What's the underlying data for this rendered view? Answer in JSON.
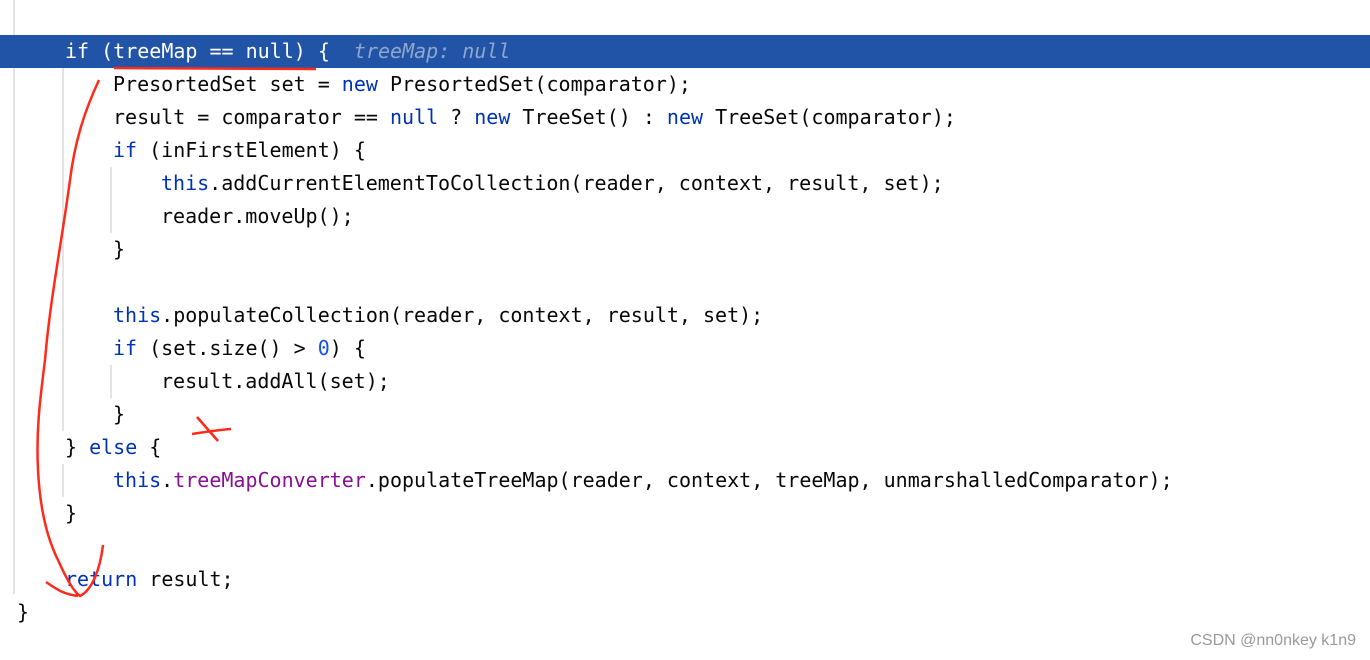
{
  "colors": {
    "highlight": "#2154a6",
    "keyword": "#0033b3",
    "number": "#1750eb",
    "field": "#871094",
    "annotation": "#ff2a1a"
  },
  "inline_hint": "treeMap: null",
  "highlighted_line": 0,
  "code_lines": [
    {
      "indent": 1,
      "tokens": [
        [
          "if",
          "kw"
        ],
        [
          " (treeMap == null) {",
          ""
        ]
      ]
    },
    {
      "indent": 2,
      "tokens": [
        [
          "PresortedSet set = ",
          ""
        ],
        [
          "new",
          "kw"
        ],
        [
          " PresortedSet(comparator);",
          ""
        ]
      ]
    },
    {
      "indent": 2,
      "tokens": [
        [
          "result = comparator == ",
          ""
        ],
        [
          "null",
          "kw"
        ],
        [
          " ? ",
          ""
        ],
        [
          "new",
          "kw"
        ],
        [
          " TreeSet() : ",
          ""
        ],
        [
          "new",
          "kw"
        ],
        [
          " TreeSet(comparator);",
          ""
        ]
      ]
    },
    {
      "indent": 2,
      "tokens": [
        [
          "if",
          "kw"
        ],
        [
          " (inFirstElement) {",
          ""
        ]
      ]
    },
    {
      "indent": 3,
      "tokens": [
        [
          "this",
          "kw"
        ],
        [
          ".addCurrentElementToCollection(reader, context, result, set);",
          ""
        ]
      ]
    },
    {
      "indent": 3,
      "tokens": [
        [
          "reader.moveUp();",
          ""
        ]
      ]
    },
    {
      "indent": 2,
      "tokens": [
        [
          "}",
          ""
        ]
      ]
    },
    {
      "indent": 0,
      "tokens": []
    },
    {
      "indent": 2,
      "tokens": [
        [
          "this",
          "kw"
        ],
        [
          ".populateCollection(reader, context, result, set);",
          ""
        ]
      ]
    },
    {
      "indent": 2,
      "tokens": [
        [
          "if",
          "kw"
        ],
        [
          " (set.size() > ",
          ""
        ],
        [
          "0",
          "num"
        ],
        [
          ") {",
          ""
        ]
      ]
    },
    {
      "indent": 3,
      "tokens": [
        [
          "result.addAll(set);",
          ""
        ]
      ]
    },
    {
      "indent": 2,
      "tokens": [
        [
          "}",
          ""
        ]
      ]
    },
    {
      "indent": 1,
      "tokens": [
        [
          "} ",
          ""
        ],
        [
          "else",
          "kw"
        ],
        [
          " {",
          ""
        ]
      ]
    },
    {
      "indent": 2,
      "tokens": [
        [
          "this",
          "kw"
        ],
        [
          ".",
          ""
        ],
        [
          "treeMapConverter",
          "field"
        ],
        [
          ".populateTreeMap(reader, context, treeMap, unmarshalledComparator);",
          ""
        ]
      ]
    },
    {
      "indent": 1,
      "tokens": [
        [
          "}",
          ""
        ]
      ]
    },
    {
      "indent": 0,
      "tokens": []
    },
    {
      "indent": 1,
      "tokens": [
        [
          "return",
          "kw"
        ],
        [
          " result;",
          ""
        ]
      ]
    },
    {
      "indent": 0,
      "tokens": [
        [
          "}",
          ""
        ]
      ]
    }
  ],
  "watermark": "CSDN @nn0nkey k1n9"
}
